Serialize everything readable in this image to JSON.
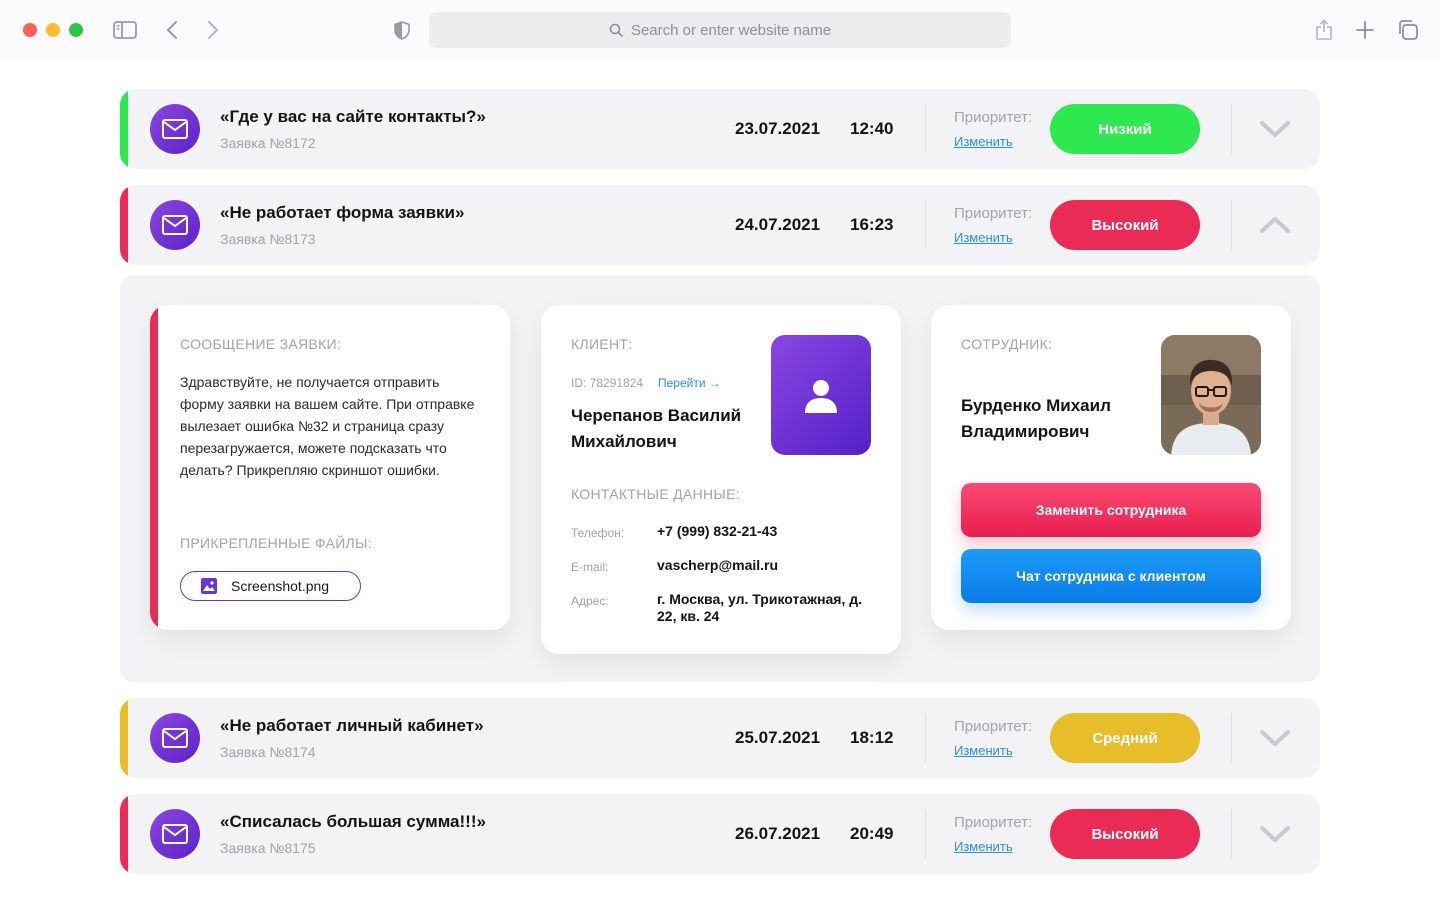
{
  "browser": {
    "search_placeholder": "Search or enter website name"
  },
  "tickets": [
    {
      "title": "«Где у вас на сайте контакты?»",
      "number": "Заявка №8172",
      "date": "23.07.2021",
      "time": "12:40",
      "priority_label": "Приоритет:",
      "change_label": "Изменить",
      "priority": "Низкий",
      "priority_color": "#2ee84f",
      "bar_color": "#2ee84f",
      "chevron": "chevron-down"
    },
    {
      "title": "«Не работает форма заявки»",
      "number": "Заявка №8173",
      "date": "24.07.2021",
      "time": "16:23",
      "priority_label": "Приоритет:",
      "change_label": "Изменить",
      "priority": "Высокий",
      "priority_color": "#ea2b55",
      "bar_color": "#ea2b55",
      "chevron": "chevron-up"
    },
    {
      "title": "«Не работает личный кабинет»",
      "number": "Заявка №8174",
      "date": "25.07.2021",
      "time": "18:12",
      "priority_label": "Приоритет:",
      "change_label": "Изменить",
      "priority": "Средний",
      "priority_color": "#e8bd2a",
      "bar_color": "#e8bd2a",
      "chevron": "chevron-down"
    },
    {
      "title": "«Списалась большая сумма!!!»",
      "number": "Заявка №8175",
      "date": "26.07.2021",
      "time": "20:49",
      "priority_label": "Приоритет:",
      "change_label": "Изменить",
      "priority": "Высокий",
      "priority_color": "#ea2b55",
      "bar_color": "#ea2b55",
      "chevron": "chevron-down"
    }
  ],
  "details": {
    "message_heading": "СООБЩЕНИЕ ЗАЯВКИ:",
    "message_text": "Здравствуйте, не получается отправить форму заявки на вашем сайте. При отправке вылезает ошибка №32 и страница сразу перезагружается, можете подсказать что делать? Прикрепляю скриншот ошибки.",
    "attachments_heading": "ПРИКРЕПЛЕННЫЕ ФАЙЛЫ:",
    "attachment_name": "Screenshot.png",
    "client_heading": "КЛИЕНТ:",
    "client_id": "ID: 78291824",
    "client_link": "Перейти →",
    "client_name_line1": "Черепанов Василий",
    "client_name_line2": "Михайлович",
    "contacts_heading": "КОНТАКТНЫЕ ДАННЫЕ:",
    "phone_label": "Телефон:",
    "phone": "+7 (999) 832-21-43",
    "email_label": "E-mail:",
    "email": "vascherp@mail.ru",
    "address_label": "Адрес:",
    "address": "г. Москва, ул. Трикотажная, д. 22, кв. 24",
    "staff_heading": "СОТРУДНИК:",
    "staff_name_line1": "Бурденко Михаил",
    "staff_name_line2": "Владимирович",
    "replace_button": "Заменить сотрудника",
    "chat_button": "Чат сотрудника с клиентом"
  }
}
